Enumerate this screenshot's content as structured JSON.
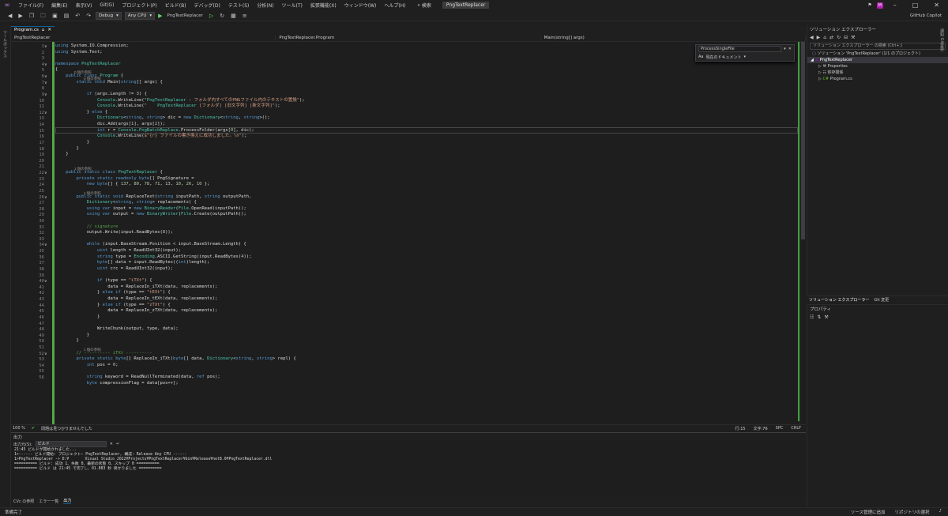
{
  "menu": {
    "items": [
      "ファイル(F)",
      "編集(E)",
      "表示(V)",
      "Git(G)",
      "プロジェクト(P)",
      "ビルド(B)",
      "デバッグ(D)",
      "テスト(S)",
      "分析(N)",
      "ツール(T)",
      "拡張機能(X)",
      "ウィンドウ(W)",
      "ヘルプ(H)"
    ],
    "search": "検索",
    "project_title": "PngTextReplacer",
    "avatar": "M"
  },
  "toolbar": {
    "config": "Debug",
    "platform": "Any CPU",
    "run_target": "PngTextReplacer",
    "copilot": "GitHub Copilot"
  },
  "left_rail": {
    "label": "ツールボックス"
  },
  "editor": {
    "tab_label": "Program.cs",
    "nav": [
      "PngTextReplacer",
      "PngTextReplacer.Program",
      "Main(string[] args)"
    ],
    "find_popup": {
      "title": "ProcessSingleFile",
      "scope": "現在のドキュメント"
    },
    "line_numbers": [
      "1",
      "2",
      "3",
      "4",
      "5",
      "6",
      "7",
      "8",
      "9",
      "10",
      "11",
      "12",
      "13",
      "14",
      "15",
      "16",
      "17",
      "18",
      "19",
      "20",
      "21",
      "22",
      "23",
      "24",
      "25",
      "26",
      "27",
      "28",
      "29",
      "30",
      "31",
      "32",
      "33",
      "34",
      "35",
      "36",
      "37",
      "38",
      "39",
      "40",
      "41",
      "42",
      "43",
      "44",
      "45",
      "46",
      "47",
      "48",
      "49",
      "50",
      "51",
      "52",
      "53",
      "54",
      "55",
      "56"
    ],
    "hints": [
      "0 個の参照",
      "0 個の参照",
      "1 個の参照",
      "1 個の参照",
      "1 個の参照"
    ],
    "code_lines": [
      "using System.IO.Compression;",
      "using System.Text;",
      "",
      "namespace PngTextReplacer",
      "{",
      "    public class Program {",
      "        static void Main(string[] args) {",
      "",
      "            if (args.Length != 3) {",
      "                Console.WriteLine(\"PngTextReplacer : フォルダ内すべてのPNGファイル内のテキストの置換\");",
      "                Console.WriteLine(\"    PngTextReplacer [フォルダ] [旧文字列] [新文字列]\");",
      "            } else {",
      "                Dictionary<string, string> dic = new Dictionary<string, string>();",
      "                dic.Add(args[1], args[2]);",
      "                int r = Console.PngBatchReplace.ProcessFolder(args[0], dic);",
      "                Console.WriteLine($\"{r} ファイルの書き換えに成功しました。\\n\");",
      "            }",
      "        }",
      "    }",
      "",
      "",
      "    public static class PngTextReplacer {",
      "        private static readonly byte[] PngSignature =",
      "            new byte[] { 137, 80, 78, 71, 13, 10, 26, 10 };",
      "",
      "        public static void ReplaceText(string inputPath, string outputPath,",
      "            Dictionary<string, string> replacements) {",
      "            using var input = new BinaryReader(File.OpenRead(inputPath));",
      "            using var output = new BinaryWriter(File.Create(outputPath));",
      "",
      "            // signature",
      "            output.Write(input.ReadBytes(8));",
      "",
      "            while (input.BaseStream.Position < input.BaseStream.Length) {",
      "                uint length = ReadUInt32(input);",
      "                string type = Encoding.ASCII.GetString(input.ReadBytes(4));",
      "                byte[] data = input.ReadBytes((int)length);",
      "                uint crc = ReadUInt32(input);",
      "",
      "                if (type == \"iTXt\") {",
      "                    data = ReplaceIn_iTXt(data, replacements);",
      "                } else if (type == \"tEXt\") {",
      "                    data = ReplaceIn_tEXt(data, replacements);",
      "                } else if (type == \"zTXt\") {",
      "                    data = ReplaceIn_zTXt(data, replacements);",
      "                }",
      "",
      "                WriteChunk(output, type, data);",
      "            }",
      "        }",
      "",
      "        // ---------- iTXt ----------",
      "        private static byte[] ReplaceIn_iTXt(byte[] data, Dictionary<string, string> repl) {",
      "            int pos = 0;",
      "",
      "            string keyword = ReadNullTerminated(data, ref pos);",
      "            byte compressionFlag = data[pos++];"
    ],
    "zoom": "100 %",
    "status_ok": "問題は見つかりませんでした",
    "position": {
      "line": "行:15",
      "col": "文字:76",
      "ins": "SPC",
      "eol": "CRLF"
    }
  },
  "output": {
    "title": "出力",
    "source_label": "出力元(S):",
    "source_value": "ビルド",
    "lines": [
      "21:45 ビルドが開始されました...",
      "1>------ ビルド開始: プロジェクト: PngTextReplacer, 構成: Release Any CPU ------",
      "1>PngTextReplacer -> D:¥       Visual Studio 2022¥Projects¥PngTextReplacer¥bin¥Release¥net8.0¥PngTextReplacer.dll",
      "========== ビルド: 成功 1、失敗 0、最新の状態 0、スキップ 0 ==========",
      "========== ビルド は 21:45 で完了し、01.883 秒 掛かりました =========="
    ],
    "tabs": [
      "CVc の参照",
      "エラー一覧",
      "出力"
    ]
  },
  "solution": {
    "title": "ソリューション エクスプローラー",
    "search_placeholder": "ソリューション エクスプローラー の検索 (Ctrl+;)",
    "root": "ソリューション 'PngTextReplacer' (1/1 のプロジェクト)",
    "project": "PngTextReplacer",
    "items": [
      "Properties",
      "依存関係",
      "Program.cs"
    ],
    "tabs": [
      "ソリューション エクスプローラー",
      "Git 変更"
    ]
  },
  "properties": {
    "title": "プロパティ"
  },
  "right_rail": {
    "label": "通知 Git変更"
  },
  "statusbar": {
    "left": "準備完了",
    "source_control": "ソース管理に追加",
    "repo": "リポジトリの選択"
  }
}
